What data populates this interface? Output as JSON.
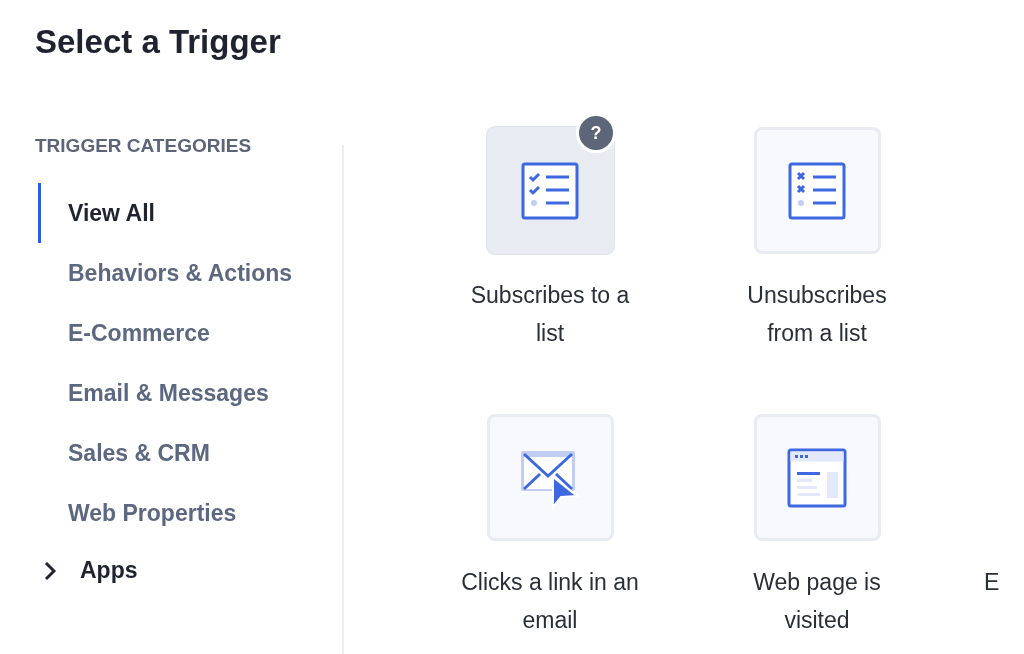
{
  "title": "Select a Trigger",
  "sidebar": {
    "heading": "TRIGGER CATEGORIES",
    "items": [
      {
        "label": "View All",
        "selected": true
      },
      {
        "label": "Behaviors & Actions",
        "selected": false
      },
      {
        "label": "E-Commerce",
        "selected": false
      },
      {
        "label": "Email & Messages",
        "selected": false
      },
      {
        "label": "Sales & CRM",
        "selected": false
      },
      {
        "label": "Web Properties",
        "selected": false
      }
    ],
    "apps": {
      "label": "Apps",
      "expanded": false
    }
  },
  "triggers": [
    {
      "kind": "subscribe",
      "label": "Subscribes to a list",
      "highlighted": true,
      "help": "?"
    },
    {
      "kind": "unsubscribe",
      "label": "Unsubscribes from a list",
      "highlighted": false
    },
    {
      "kind": "cut"
    },
    {
      "kind": "email-click",
      "label": "Clicks a link in an email",
      "highlighted": false
    },
    {
      "kind": "webpage",
      "label": "Web page is visited",
      "highlighted": false
    },
    {
      "kind": "cut",
      "label": "E"
    }
  ]
}
